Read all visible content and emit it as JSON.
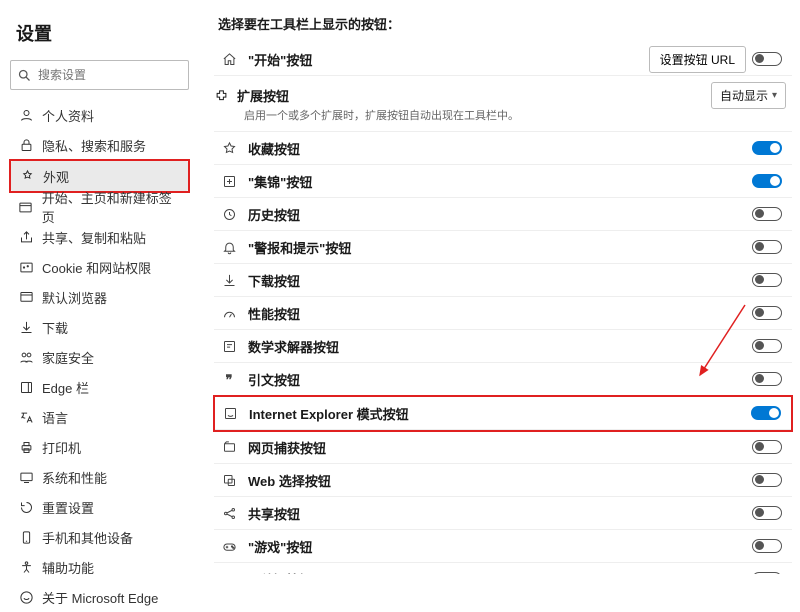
{
  "sidebar": {
    "title": "设置",
    "search_placeholder": "搜索设置",
    "items": [
      {
        "icon": "profile",
        "label": "个人资料"
      },
      {
        "icon": "lock",
        "label": "隐私、搜索和服务"
      },
      {
        "icon": "appearance",
        "label": "外观",
        "active": true
      },
      {
        "icon": "newtab",
        "label": "开始、主页和新建标签页"
      },
      {
        "icon": "share",
        "label": "共享、复制和粘贴"
      },
      {
        "icon": "cookie",
        "label": "Cookie 和网站权限"
      },
      {
        "icon": "browser",
        "label": "默认浏览器"
      },
      {
        "icon": "download",
        "label": "下载"
      },
      {
        "icon": "family",
        "label": "家庭安全"
      },
      {
        "icon": "edgebar",
        "label": "Edge 栏"
      },
      {
        "icon": "lang",
        "label": "语言"
      },
      {
        "icon": "printer",
        "label": "打印机"
      },
      {
        "icon": "system",
        "label": "系统和性能"
      },
      {
        "icon": "reset",
        "label": "重置设置"
      },
      {
        "icon": "phone",
        "label": "手机和其他设备"
      },
      {
        "icon": "accessibility",
        "label": "辅助功能"
      },
      {
        "icon": "about",
        "label": "关于 Microsoft Edge"
      }
    ]
  },
  "main": {
    "section_title": "选择要在工具栏上显示的按钮：",
    "home": {
      "label": "\"开始\"按钮",
      "button": "设置按钮 URL",
      "toggle": "off"
    },
    "extensions": {
      "label": "扩展按钮",
      "desc": "启用一个或多个扩展时，扩展按钮自动出现在工具栏中。",
      "select": "自动显示"
    },
    "items": [
      {
        "icon": "star",
        "label": "收藏按钮",
        "toggle": "on"
      },
      {
        "icon": "collections",
        "label": "\"集锦\"按钮",
        "toggle": "on"
      },
      {
        "icon": "history",
        "label": "历史按钮",
        "toggle": "off"
      },
      {
        "icon": "bell",
        "label": "\"警报和提示\"按钮",
        "toggle": "off"
      },
      {
        "icon": "download",
        "label": "下载按钮",
        "toggle": "off"
      },
      {
        "icon": "perf",
        "label": "性能按钮",
        "toggle": "off"
      },
      {
        "icon": "math",
        "label": "数学求解器按钮",
        "toggle": "off"
      },
      {
        "icon": "quote",
        "label": "引文按钮",
        "toggle": "off"
      },
      {
        "icon": "ie",
        "label": "Internet Explorer 模式按钮",
        "toggle": "on",
        "highlight": true
      },
      {
        "icon": "capture",
        "label": "网页捕获按钮",
        "toggle": "off"
      },
      {
        "icon": "webselect",
        "label": "Web 选择按钮",
        "toggle": "off"
      },
      {
        "icon": "share2",
        "label": "共享按钮",
        "toggle": "off"
      },
      {
        "icon": "games",
        "label": "\"游戏\"按钮",
        "toggle": "off"
      },
      {
        "icon": "feedback",
        "label": "\"反馈\"按钮",
        "toggle": "off"
      }
    ]
  }
}
